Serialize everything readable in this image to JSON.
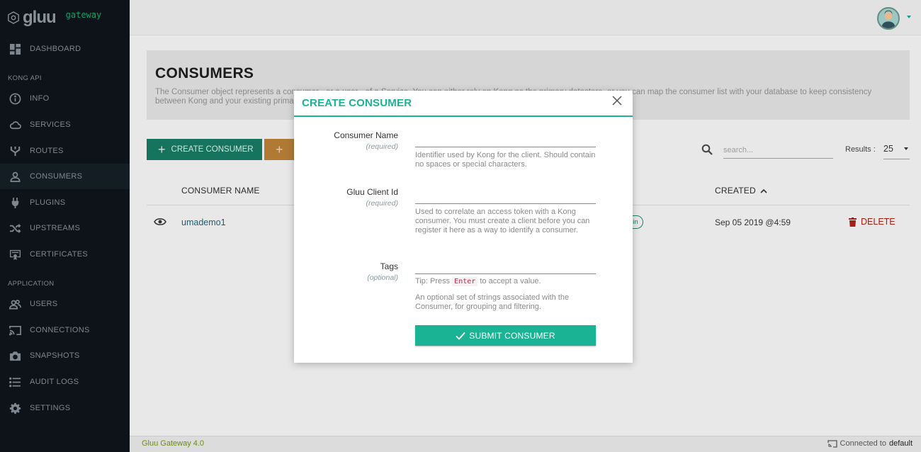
{
  "brand": {
    "name": "gluu",
    "sub": "gateway"
  },
  "sidebar": {
    "top_items": [
      {
        "label": "DASHBOARD",
        "icon": "dashboard-icon"
      }
    ],
    "sections": [
      {
        "title": "KONG API"
      },
      {
        "title": "APPLICATION"
      }
    ],
    "kong_items": [
      {
        "label": "INFO",
        "icon": "info-icon"
      },
      {
        "label": "SERVICES",
        "icon": "cloud-icon"
      },
      {
        "label": "ROUTES",
        "icon": "routes-icon"
      },
      {
        "label": "CONSUMERS",
        "icon": "user-icon",
        "active": true
      },
      {
        "label": "PLUGINS",
        "icon": "plug-icon"
      },
      {
        "label": "UPSTREAMS",
        "icon": "shuffle-icon"
      },
      {
        "label": "CERTIFICATES",
        "icon": "certificate-icon"
      }
    ],
    "app_items": [
      {
        "label": "USERS",
        "icon": "users-icon"
      },
      {
        "label": "CONNECTIONS",
        "icon": "cast-icon"
      },
      {
        "label": "SNAPSHOTS",
        "icon": "camera-icon"
      },
      {
        "label": "AUDIT LOGS",
        "icon": "list-icon"
      },
      {
        "label": "SETTINGS",
        "icon": "gear-icon"
      }
    ]
  },
  "page": {
    "title": "CONSUMERS",
    "description": "The Consumer object represents a consumer - or a user - of a Service. You can either rely on Kong as the primary datastore, or you can map the consumer list with your database to keep consistency between Kong and your existing primary datastore."
  },
  "toolbar": {
    "create_label": "CREATE CONSUMER",
    "search_placeholder": "search...",
    "results_label": "Results :",
    "results_value": "25"
  },
  "table": {
    "headers": {
      "name": "CONSUMER NAME",
      "created": "CREATED"
    },
    "rows": [
      {
        "name": "umademo1",
        "badge": "gin",
        "created": "Sep 05 2019 @4:59",
        "delete": "DELETE"
      }
    ]
  },
  "modal": {
    "title": "CREATE CONSUMER",
    "fields": {
      "consumer_name": {
        "label": "Consumer Name",
        "req": "(required)",
        "help": "Identifier used by Kong for the client. Should contain no spaces or special characters."
      },
      "client_id": {
        "label": "Gluu Client Id",
        "req": "(required)",
        "help": "Used to correlate an access token with a Kong consumer. You must create a client before you can register it here as a way to identify a consumer."
      },
      "tags": {
        "label": "Tags",
        "req": "(optional)",
        "tip_pre": "Tip: Press",
        "tip_key": "Enter",
        "tip_post": "to accept a value.",
        "help": "An optional set of strings associated with the Consumer, for grouping and filtering."
      }
    },
    "submit_label": "SUBMIT CONSUMER"
  },
  "footer": {
    "version": "Gluu Gateway 4.0",
    "connected_pre": "Connected to",
    "connected_name": "default"
  },
  "colors": {
    "sidebar_bg": "#0d1318",
    "accent": "#1ab394",
    "create_btn": "#16735e",
    "delete": "#a32018"
  }
}
